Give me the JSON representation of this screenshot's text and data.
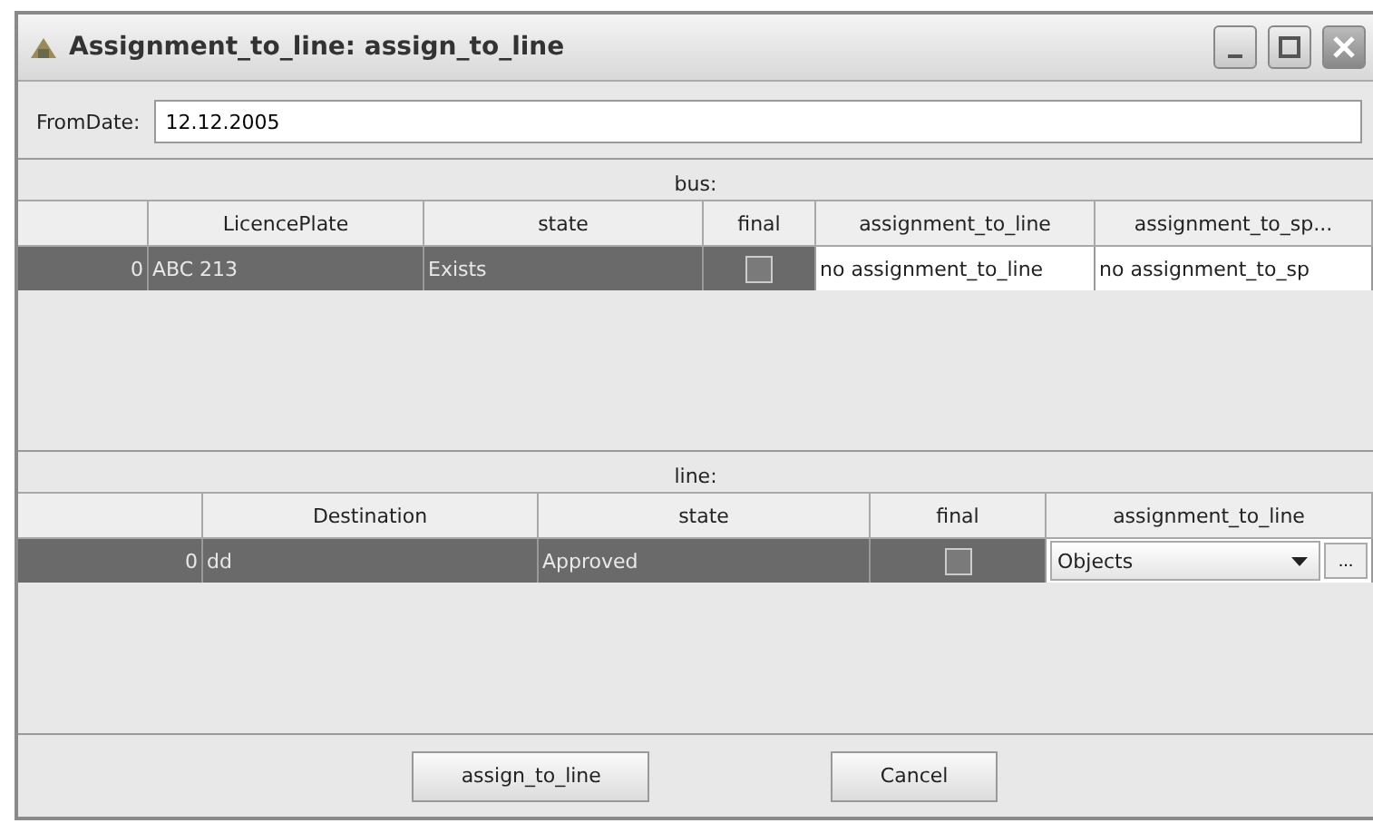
{
  "window": {
    "title": "Assignment_to_line: assign_to_line"
  },
  "from_date": {
    "label": "FromDate:",
    "value": "12.12.2005"
  },
  "tables": [
    {
      "caption": "bus:",
      "columns": [
        "",
        "LicencePlate",
        "state",
        "final",
        "assignment_to_line",
        "assignment_to_sp..."
      ],
      "rows": [
        {
          "cells": [
            {
              "kind": "number",
              "text": "0",
              "selected": true
            },
            {
              "kind": "text",
              "text": "ABC 213",
              "selected": true
            },
            {
              "kind": "text",
              "text": "Exists",
              "selected": true
            },
            {
              "kind": "checkbox",
              "checked": false,
              "selected": true
            },
            {
              "kind": "text",
              "text": "no assignment_to_line",
              "selected": false
            },
            {
              "kind": "text",
              "text": "no assignment_to_sp",
              "selected": false
            }
          ]
        }
      ]
    },
    {
      "caption": "line:",
      "columns": [
        "",
        "Destination",
        "state",
        "final",
        "assignment_to_line"
      ],
      "rows": [
        {
          "cells": [
            {
              "kind": "number",
              "text": "0",
              "selected": true
            },
            {
              "kind": "text",
              "text": "dd",
              "selected": true
            },
            {
              "kind": "text",
              "text": "Approved",
              "selected": true
            },
            {
              "kind": "checkbox",
              "checked": false,
              "selected": true
            },
            {
              "kind": "combo",
              "text": "Objects",
              "button": "...",
              "selected": false
            }
          ]
        }
      ]
    }
  ],
  "buttons": [
    "assign_to_line",
    "Cancel"
  ]
}
